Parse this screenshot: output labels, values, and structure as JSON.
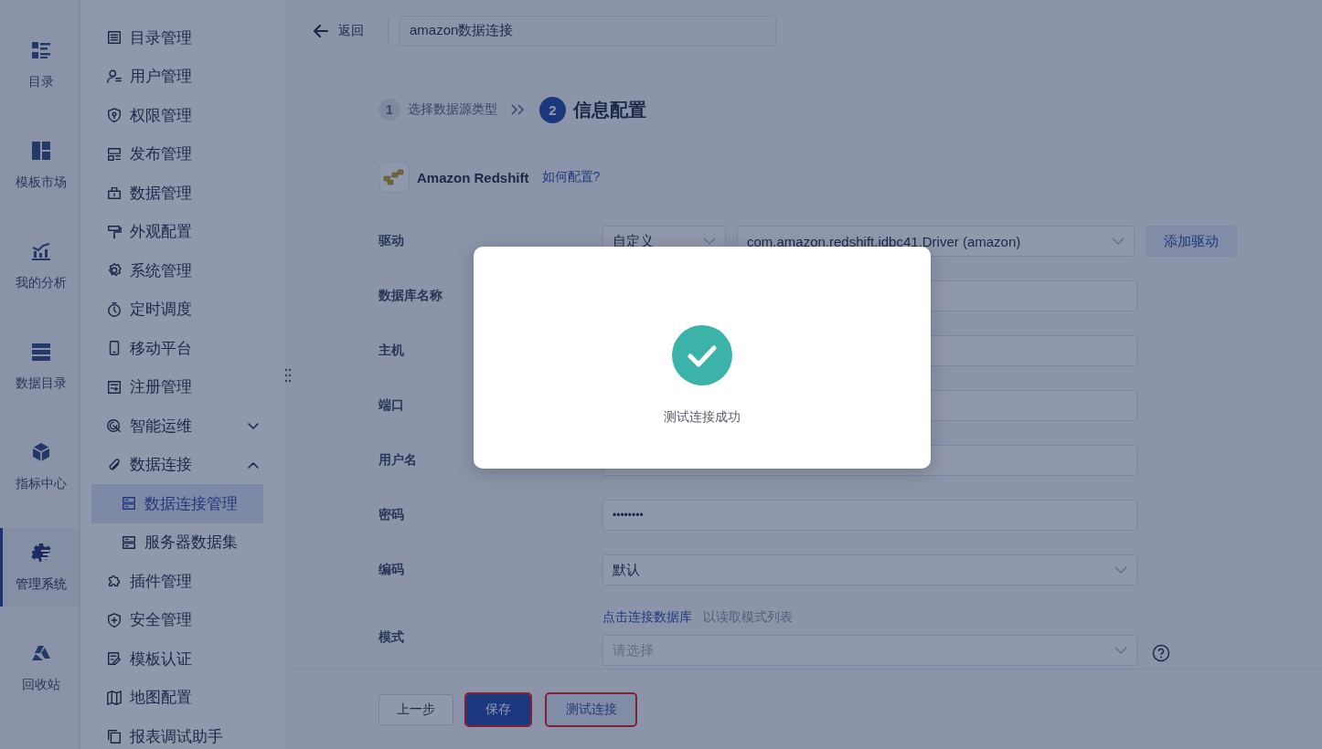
{
  "rail": {
    "items": [
      {
        "label": "目录",
        "selected": false
      },
      {
        "label": "模板市场",
        "selected": false
      },
      {
        "label": "我的分析",
        "selected": false
      },
      {
        "label": "数据目录",
        "selected": false
      },
      {
        "label": "指标中心",
        "selected": false
      },
      {
        "label": "管理系统",
        "selected": true
      },
      {
        "label": "回收站",
        "selected": false
      }
    ]
  },
  "menu": {
    "items": [
      {
        "label": "目录管理",
        "selected": false
      },
      {
        "label": "用户管理",
        "selected": false
      },
      {
        "label": "权限管理",
        "selected": false
      },
      {
        "label": "发布管理",
        "selected": false
      },
      {
        "label": "数据管理",
        "selected": false
      },
      {
        "label": "外观配置",
        "selected": false
      },
      {
        "label": "系统管理",
        "selected": false
      },
      {
        "label": "定时调度",
        "selected": false
      },
      {
        "label": "移动平台",
        "selected": false
      },
      {
        "label": "注册管理",
        "selected": false
      },
      {
        "label": "智能运维",
        "selected": false,
        "expanded": false
      },
      {
        "label": "数据连接",
        "selected": false,
        "expanded": true,
        "children": [
          {
            "label": "数据连接管理",
            "selected": true
          },
          {
            "label": "服务器数据集",
            "selected": false
          }
        ]
      },
      {
        "label": "插件管理",
        "selected": false
      },
      {
        "label": "安全管理",
        "selected": false
      },
      {
        "label": "模板认证",
        "selected": false
      },
      {
        "label": "地图配置",
        "selected": false
      },
      {
        "label": "报表调试助手",
        "selected": false
      }
    ]
  },
  "topbar": {
    "back_label": "返回",
    "name_field": {
      "value": "amazon数据连接"
    }
  },
  "steps": [
    {
      "number": "1",
      "label": "选择数据源类型",
      "selected": false
    },
    {
      "number": "2",
      "label": "信息配置",
      "selected": true
    }
  ],
  "datasource": {
    "name": "Amazon Redshift",
    "help_link": "如何配置?"
  },
  "form": {
    "rows": [
      {
        "kind": "driver",
        "label": "驱动",
        "type_select": "自定义",
        "driver_select": "com.amazon.redshift.jdbc41.Driver (amazon)",
        "button": "添加驱动"
      },
      {
        "kind": "text",
        "label": "数据库名称"
      },
      {
        "kind": "text",
        "label": "主机"
      },
      {
        "kind": "text",
        "label": "端口"
      },
      {
        "kind": "text",
        "label": "用户名"
      },
      {
        "kind": "password",
        "label": "密码",
        "value": "••••••••"
      },
      {
        "kind": "select",
        "label": "编码",
        "value": "默认"
      },
      {
        "kind": "schema",
        "label": "模式",
        "link": "点击连接数据库",
        "hint": "以读取模式列表",
        "placeholder": "请选择"
      }
    ]
  },
  "footer": {
    "buttons": [
      {
        "label": "上一步",
        "kind": "default",
        "highlighted": false
      },
      {
        "label": "保存",
        "kind": "primary",
        "highlighted": true
      },
      {
        "label": "测试连接",
        "kind": "secondary",
        "highlighted": true
      }
    ]
  },
  "modal": {
    "kind": "success",
    "message": "测试连接成功"
  }
}
